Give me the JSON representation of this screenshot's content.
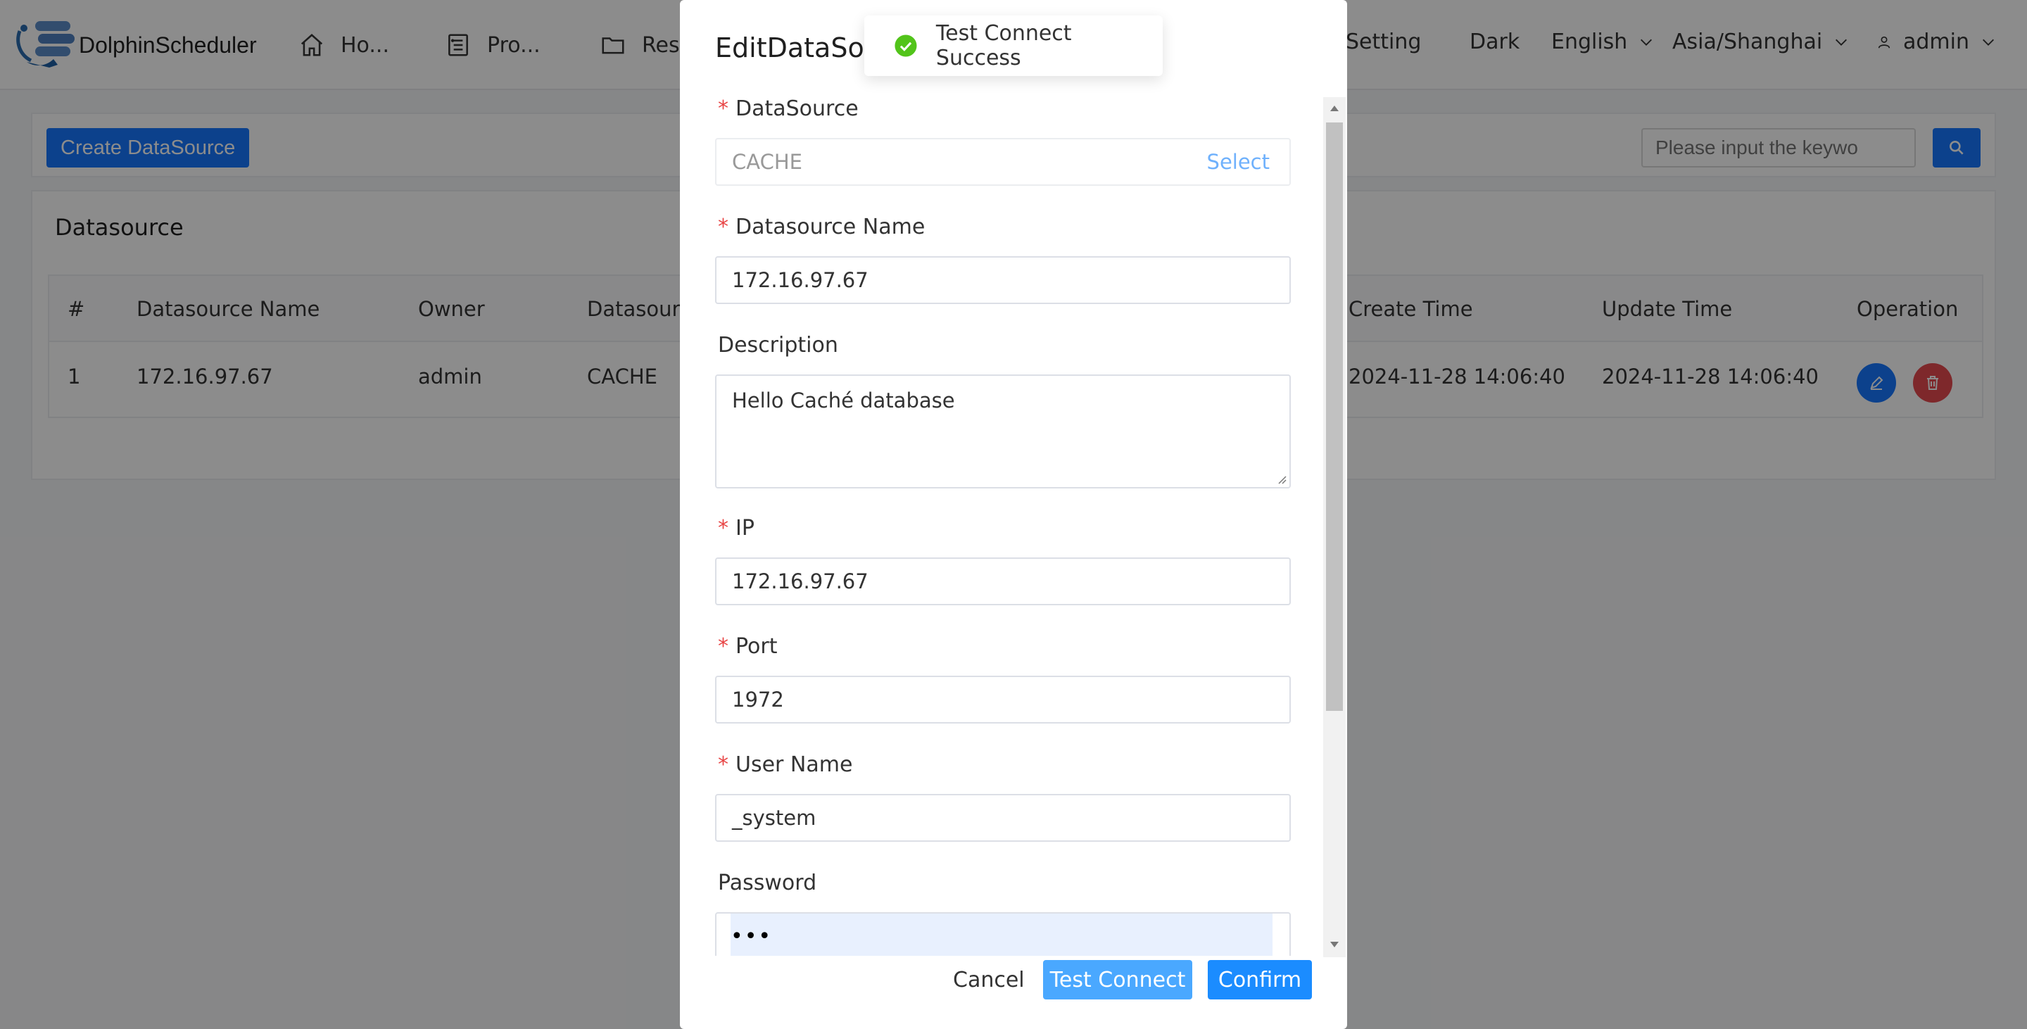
{
  "header": {
    "brand": "DolphinScheduler",
    "nav": [
      {
        "label": "Ho...",
        "icon": "home-icon"
      },
      {
        "label": "Pro...",
        "icon": "project-icon"
      },
      {
        "label": "Reso",
        "icon": "folder-icon"
      }
    ],
    "setting": "Setting",
    "theme": "Dark",
    "language": "English",
    "timezone": "Asia/Shanghai",
    "user": "admin"
  },
  "toolbar": {
    "create_label": "Create DataSource",
    "search_placeholder": "Please input the keywo"
  },
  "datasource_card": {
    "title": "Datasource",
    "columns": [
      "#",
      "Datasource Name",
      "Owner",
      "Datasourc",
      "Create Time",
      "Update Time",
      "Operation"
    ],
    "rows": [
      {
        "index": "1",
        "name": "172.16.97.67",
        "owner": "admin",
        "type": "CACHE",
        "create_time": "2024-11-28 14:06:40",
        "update_time": "2024-11-28 14:06:40"
      }
    ]
  },
  "modal": {
    "title": "EditDataSou",
    "fields": {
      "datasource": {
        "label": "DataSource",
        "value": "CACHE",
        "action": "Select"
      },
      "name": {
        "label": "Datasource Name",
        "value": "172.16.97.67"
      },
      "description": {
        "label": "Description",
        "value": "Hello Caché database"
      },
      "ip": {
        "label": "IP",
        "value": "172.16.97.67"
      },
      "port": {
        "label": "Port",
        "value": "1972"
      },
      "username": {
        "label": "User Name",
        "value": "_system"
      },
      "password": {
        "label": "Password",
        "value": "•••"
      }
    },
    "required_mark": "*",
    "cancel": "Cancel",
    "test_connect": "Test Connect",
    "confirm": "Confirm"
  },
  "toast": {
    "message": "Test Connect Success"
  },
  "colors": {
    "primary": "#1677ff",
    "danger": "#e54a4f",
    "success": "#52c41a"
  }
}
